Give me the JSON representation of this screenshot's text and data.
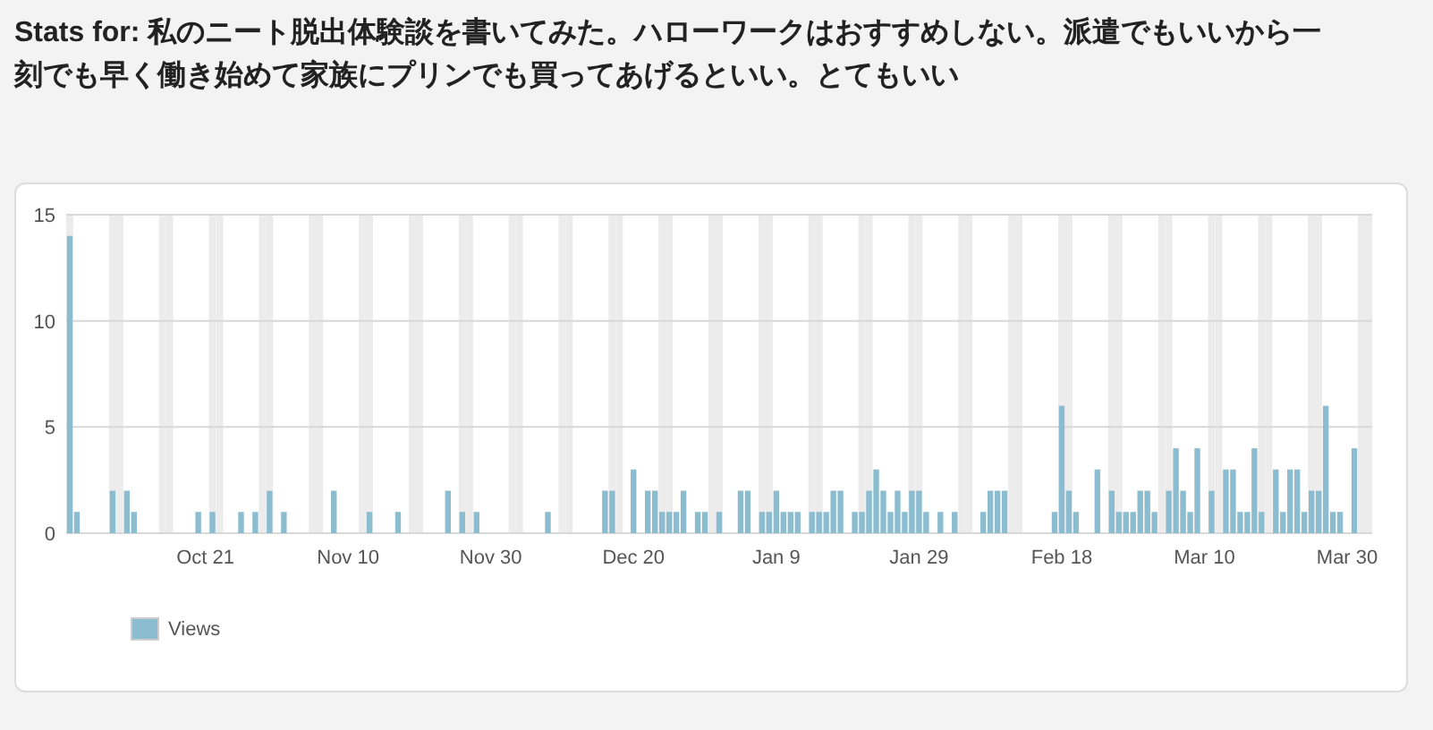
{
  "title": "Stats for: 私のニート脱出体験談を書いてみた。ハローワークはおすすめしない。派遣でもいいから一刻でも早く働き始めて家族にプリンでも買ってあげるといい。とてもいい",
  "chart": {
    "chart_data": {
      "type": "bar",
      "ylim": [
        0,
        15
      ],
      "yticks": [
        0,
        5,
        10,
        15
      ],
      "categories": [
        null,
        null,
        null,
        null,
        null,
        null,
        null,
        null,
        null,
        null,
        null,
        null,
        null,
        null,
        null,
        null,
        null,
        null,
        null,
        "Oct 21",
        null,
        null,
        null,
        null,
        null,
        null,
        null,
        null,
        null,
        null,
        null,
        null,
        null,
        null,
        null,
        null,
        null,
        null,
        null,
        "Nov 10",
        null,
        null,
        null,
        null,
        null,
        null,
        null,
        null,
        null,
        null,
        null,
        null,
        null,
        null,
        null,
        null,
        null,
        null,
        null,
        "Nov 30",
        null,
        null,
        null,
        null,
        null,
        null,
        null,
        null,
        null,
        null,
        null,
        null,
        null,
        null,
        null,
        null,
        null,
        null,
        null,
        "Dec 20",
        null,
        null,
        null,
        null,
        null,
        null,
        null,
        null,
        null,
        null,
        null,
        null,
        null,
        null,
        null,
        null,
        null,
        null,
        null,
        "Jan 9",
        null,
        null,
        null,
        null,
        null,
        null,
        null,
        null,
        null,
        null,
        null,
        null,
        null,
        null,
        null,
        null,
        null,
        null,
        null,
        "Jan 29",
        null,
        null,
        null,
        null,
        null,
        null,
        null,
        null,
        null,
        null,
        null,
        null,
        null,
        null,
        null,
        null,
        null,
        null,
        null,
        "Feb 18",
        null,
        null,
        null,
        null,
        null,
        null,
        null,
        null,
        null,
        null,
        null,
        null,
        null,
        null,
        null,
        null,
        null,
        null,
        null,
        "Mar 10",
        null,
        null,
        null,
        null,
        null,
        null,
        null,
        null,
        null,
        null,
        null,
        null,
        null,
        null,
        null,
        null,
        null,
        null,
        null,
        "Mar 30",
        null,
        null,
        null
      ],
      "series": [
        {
          "name": "Views",
          "color": "#8bbcd0",
          "values": [
            14,
            1,
            0,
            0,
            0,
            0,
            2,
            0,
            2,
            1,
            0,
            0,
            0,
            0,
            0,
            0,
            0,
            0,
            1,
            0,
            1,
            0,
            0,
            0,
            1,
            0,
            1,
            0,
            2,
            0,
            1,
            0,
            0,
            0,
            0,
            0,
            0,
            2,
            0,
            0,
            0,
            0,
            1,
            0,
            0,
            0,
            1,
            0,
            0,
            0,
            0,
            0,
            0,
            2,
            0,
            1,
            0,
            1,
            0,
            0,
            0,
            0,
            0,
            0,
            0,
            0,
            0,
            1,
            0,
            0,
            0,
            0,
            0,
            0,
            0,
            2,
            2,
            0,
            0,
            3,
            0,
            2,
            2,
            1,
            1,
            1,
            2,
            0,
            1,
            1,
            0,
            1,
            0,
            0,
            2,
            2,
            0,
            1,
            1,
            2,
            1,
            1,
            1,
            0,
            1,
            1,
            1,
            2,
            2,
            0,
            1,
            1,
            2,
            3,
            2,
            1,
            2,
            1,
            2,
            2,
            1,
            0,
            1,
            0,
            1,
            0,
            0,
            0,
            1,
            2,
            2,
            2,
            0,
            0,
            0,
            0,
            0,
            0,
            1,
            6,
            2,
            1,
            0,
            0,
            3,
            0,
            2,
            1,
            1,
            1,
            2,
            2,
            1,
            0,
            2,
            4,
            2,
            1,
            4,
            0,
            2,
            0,
            3,
            3,
            1,
            1,
            4,
            1,
            0,
            3,
            1,
            3,
            3,
            1,
            2,
            2,
            6,
            1,
            1,
            0,
            4,
            0,
            0
          ]
        }
      ]
    }
  }
}
